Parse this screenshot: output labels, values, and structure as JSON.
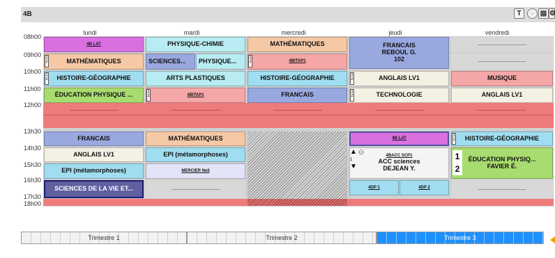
{
  "class_label": "4B",
  "days": [
    "lundi",
    "mardi",
    "mercredi",
    "jeudi",
    "vendredi"
  ],
  "times": [
    "08h00",
    "09h00",
    "10h00",
    "11h00",
    "12h00",
    "13h30",
    "14h30",
    "15h30",
    "16h30",
    "17h30",
    "18h00"
  ],
  "slots": {
    "lun_1": "4B LAT",
    "lun_2": "MATHÉMATIQUES",
    "lun_3": "HISTOIRE-GÉOGRAPHIE",
    "lun_4": "ÉDUCATION PHYSIQUE ...",
    "lun_5": "FRANCAIS",
    "lun_6": "ANGLAIS LV1",
    "lun_7": "EPI (métamorphoses)",
    "lun_8": "SCIENCES DE LA VIE ET...",
    "mar_1": "PHYSIQUE-CHIMIE",
    "mar_2a": "SCIENCES...",
    "mar_2b": "PHYSIQUE...",
    "mar_3": "ARTS PLASTIQUES",
    "mar_4": "4BITAP1",
    "mar_5": "MATHÉMATIQUES",
    "mar_6": "EPI (métamorphoses)",
    "mar_7": "MERCIER Nell",
    "mer_1": "MATHÉMATIQUES",
    "mer_2": "4BITAP1",
    "mer_3": "HISTOIRE-GÉOGRAPHIE",
    "mer_4": "FRANCAIS",
    "jeu_1a": "FRANCAIS",
    "jeu_1b": "REBOUL G.",
    "jeu_1c": "102",
    "jeu_2": "ANGLAIS LV1",
    "jeu_3": "TECHNOLOGIE",
    "jeu_4": "4B LAT",
    "jeu_5a": "4BACC SCP1",
    "jeu_5b": "ACC sciences",
    "jeu_5c": "DEJEAN Y.",
    "jeu_6a": "4DP 1",
    "jeu_6b": "4DP 2",
    "ven_1": "MUSIQUE",
    "ven_2": "ANGLAIS LV1",
    "ven_3": "HISTOIRE-GÉOGRAPHIE",
    "ven_4a": "ÉDUCATION PHYSIQ...",
    "ven_4b": "FAVIER É."
  },
  "trimesters": [
    "Trimestre 1",
    "Trimestre 2",
    "Trimestre 3"
  ],
  "colors": {
    "magenta": "#d970e0",
    "cyan": "#b8ecf2",
    "salmon": "#f2b08c",
    "blue": "#9aa8e0",
    "gray": "#d8d8d8",
    "red": "#ee7a7a",
    "green": "#a8dc70",
    "pink": "#f5a6a6",
    "lavender": "#e4e4f8",
    "selected": "#1e90ff"
  }
}
